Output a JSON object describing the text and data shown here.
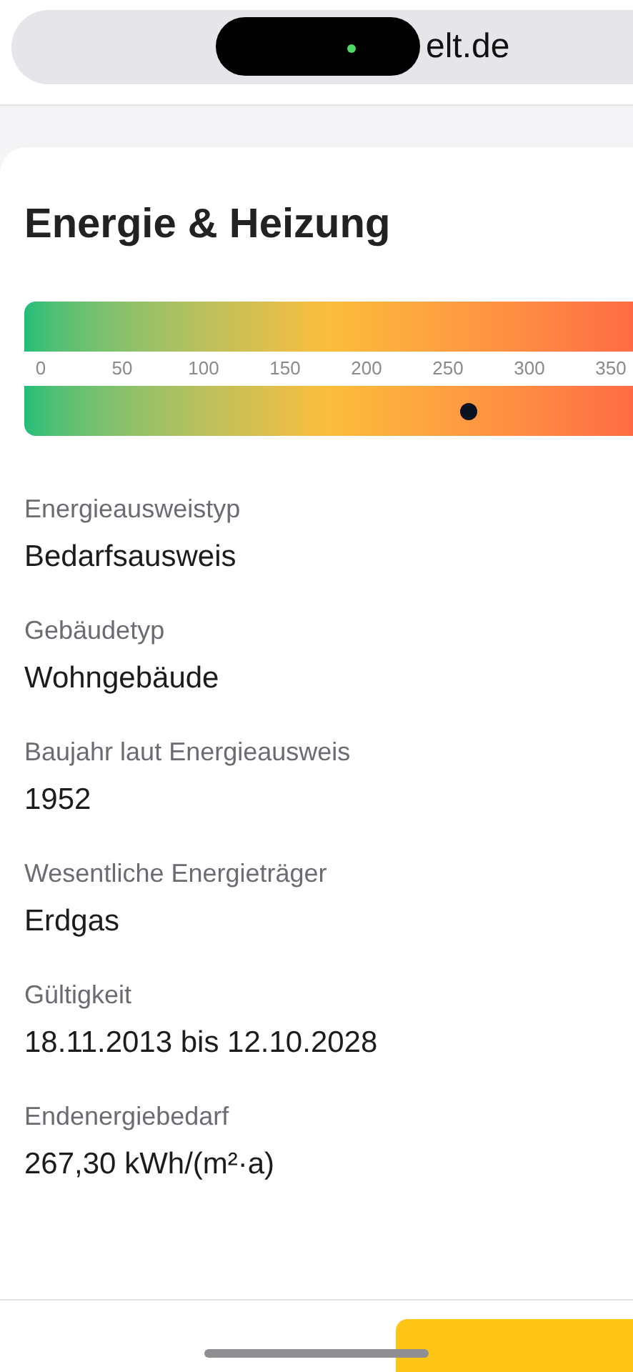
{
  "address_bar": {
    "url": "elt.de"
  },
  "section": {
    "title": "Energie & Heizung"
  },
  "energy_scale": {
    "ticks": [
      "0",
      "50",
      "100",
      "150",
      "200",
      "250",
      "300",
      "350"
    ],
    "level": 0.73
  },
  "fields": [
    {
      "label": "Energieausweistyp",
      "value": "Bedarfsausweis"
    },
    {
      "label": "Gebäudetyp",
      "value": "Wohngebäude"
    },
    {
      "label": "Baujahr laut Energieausweis",
      "value": "1952"
    },
    {
      "label": "Wesentliche Energieträger",
      "value": "Erdgas"
    },
    {
      "label": "Gültigkeit",
      "value": "18.11.2013 bis 12.10.2028"
    },
    {
      "label": "Endenergiebedarf",
      "value": "267,30 kWh/(m²·a)"
    }
  ]
}
